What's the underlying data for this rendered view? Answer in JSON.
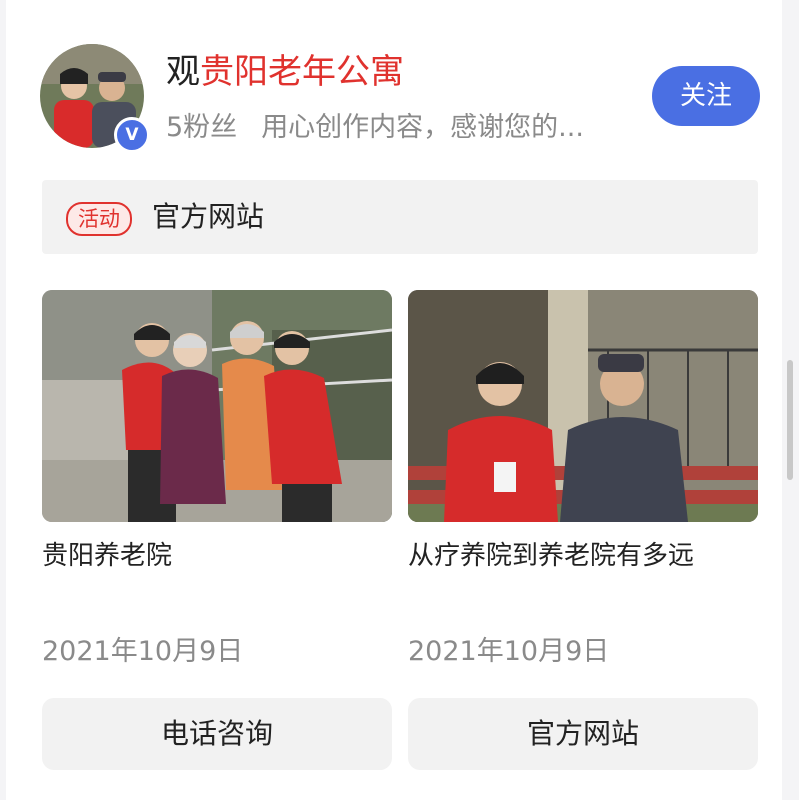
{
  "header": {
    "name_prefix": "观",
    "name_highlight": "贵阳老年公寓",
    "followers": "5粉丝",
    "description": "用心创作内容，感谢您的...",
    "follow_label": "关注",
    "verified_mark": "V",
    "verified_icon": "verified-badge-icon"
  },
  "activity": {
    "tag": "活动",
    "link": "官方网站"
  },
  "posts": [
    {
      "title": "贵阳养老院",
      "date": "2021年10月9日",
      "image": "photo-caregivers-with-elderly-women"
    },
    {
      "title": "从疗养院到养老院有多远",
      "date": "2021年10月9日",
      "image": "photo-caregiver-with-elderly-man-on-bench"
    }
  ],
  "actions": {
    "phone_label": "电话咨询",
    "website_label": "官方网站"
  },
  "colors": {
    "accent": "#4a6fe3",
    "highlight_red": "#e0322e",
    "muted_text": "#8a8a8a"
  }
}
